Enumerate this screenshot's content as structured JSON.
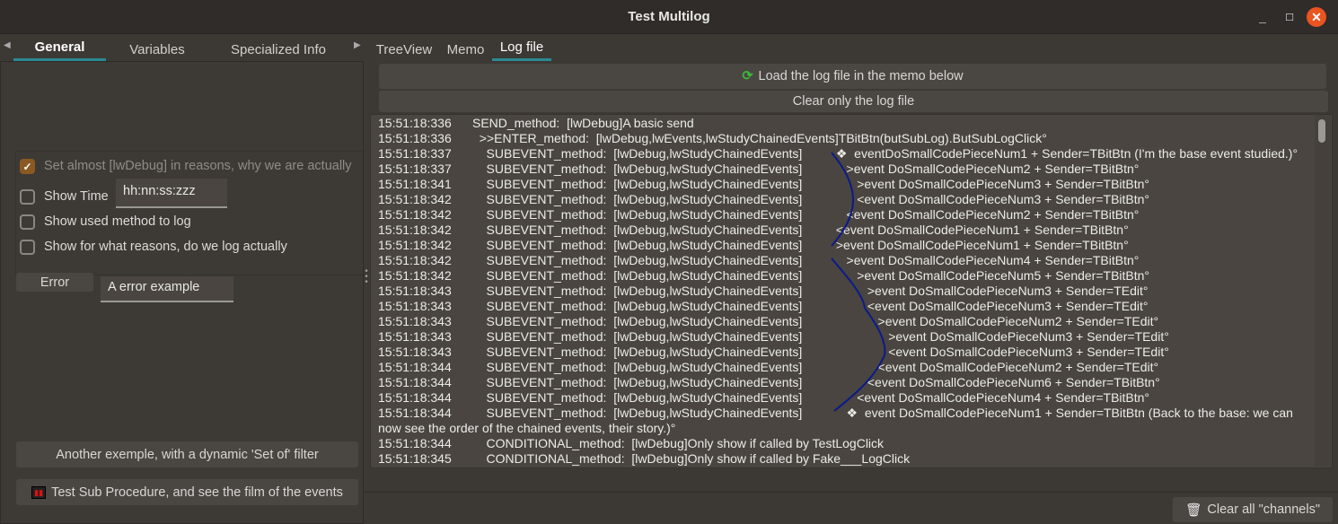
{
  "window": {
    "title": "Test Multilog",
    "minimize": "_",
    "maximize": "□",
    "close": "✕",
    "close_color": "#e95420"
  },
  "left_tabs": [
    {
      "label": "General",
      "active": true
    },
    {
      "label": "Variables"
    },
    {
      "label": "Specialized Info"
    }
  ],
  "right_tabs": [
    {
      "label": "TreeView"
    },
    {
      "label": "Memo"
    },
    {
      "label": "Log file",
      "active": true
    }
  ],
  "general": {
    "options": [
      {
        "label": "Set almost [lwDebug] in reasons, why we are actually",
        "checked": true,
        "disabled": true
      },
      {
        "label": "Show Time",
        "checked": false
      },
      {
        "label": "Show used method to log",
        "checked": false
      },
      {
        "label": "Show for what reasons, do we log actually",
        "checked": false
      }
    ],
    "time_format": "hh:nn:ss:zzz",
    "error_button": "Error",
    "error_text": "A error example",
    "set_of_button": "Another exemple, with a dynamic 'Set of' filter",
    "sub_procedure_button": "Test Sub Procedure, and see the film of the events"
  },
  "logfile": {
    "load_button": "Load the log file in the memo below",
    "clear_button": "Clear only the log file",
    "lines": [
      {
        "time": "15:51:18:336",
        "method": "SEND_method:",
        "tags": "[lwDebug]A basic send",
        "event": ""
      },
      {
        "time": "15:51:18:336",
        "method": "  >>ENTER_method:",
        "tags": "[lwDebug,lwEvents,lwStudyChainedEvents]TBitBtn(butSubLog).ButSubLogClick°",
        "event": ""
      },
      {
        "time": "15:51:18:337",
        "method": "    SUBEVENT_method:",
        "tags": "[lwDebug,lwStudyChainedEvents]",
        "event": "   ❖  eventDoSmallCodePieceNum1 + Sender=TBitBtn (I'm the base event studied.)°"
      },
      {
        "time": "15:51:18:337",
        "method": "    SUBEVENT_method:",
        "tags": "[lwDebug,lwStudyChainedEvents]",
        "event": "      >event DoSmallCodePieceNum2 + Sender=TBitBtn°"
      },
      {
        "time": "15:51:18:341",
        "method": "    SUBEVENT_method:",
        "tags": "[lwDebug,lwStudyChainedEvents]",
        "event": "         >event DoSmallCodePieceNum3 + Sender=TBitBtn°"
      },
      {
        "time": "15:51:18:342",
        "method": "    SUBEVENT_method:",
        "tags": "[lwDebug,lwStudyChainedEvents]",
        "event": "         <event DoSmallCodePieceNum3 + Sender=TBitBtn°"
      },
      {
        "time": "15:51:18:342",
        "method": "    SUBEVENT_method:",
        "tags": "[lwDebug,lwStudyChainedEvents]",
        "event": "      <event DoSmallCodePieceNum2 + Sender=TBitBtn°"
      },
      {
        "time": "15:51:18:342",
        "method": "    SUBEVENT_method:",
        "tags": "[lwDebug,lwStudyChainedEvents]",
        "event": "   <event DoSmallCodePieceNum1 + Sender=TBitBtn°"
      },
      {
        "time": "15:51:18:342",
        "method": "    SUBEVENT_method:",
        "tags": "[lwDebug,lwStudyChainedEvents]",
        "event": "   >event DoSmallCodePieceNum1 + Sender=TBitBtn°"
      },
      {
        "time": "15:51:18:342",
        "method": "    SUBEVENT_method:",
        "tags": "[lwDebug,lwStudyChainedEvents]",
        "event": "      >event DoSmallCodePieceNum4 + Sender=TBitBtn°"
      },
      {
        "time": "15:51:18:342",
        "method": "    SUBEVENT_method:",
        "tags": "[lwDebug,lwStudyChainedEvents]",
        "event": "         >event DoSmallCodePieceNum5 + Sender=TBitBtn°"
      },
      {
        "time": "15:51:18:343",
        "method": "    SUBEVENT_method:",
        "tags": "[lwDebug,lwStudyChainedEvents]",
        "event": "            >event DoSmallCodePieceNum3 + Sender=TEdit°"
      },
      {
        "time": "15:51:18:343",
        "method": "    SUBEVENT_method:",
        "tags": "[lwDebug,lwStudyChainedEvents]",
        "event": "            <event DoSmallCodePieceNum3 + Sender=TEdit°"
      },
      {
        "time": "15:51:18:343",
        "method": "    SUBEVENT_method:",
        "tags": "[lwDebug,lwStudyChainedEvents]",
        "event": "               >event DoSmallCodePieceNum2 + Sender=TEdit°"
      },
      {
        "time": "15:51:18:343",
        "method": "    SUBEVENT_method:",
        "tags": "[lwDebug,lwStudyChainedEvents]",
        "event": "                  >event DoSmallCodePieceNum3 + Sender=TEdit°"
      },
      {
        "time": "15:51:18:343",
        "method": "    SUBEVENT_method:",
        "tags": "[lwDebug,lwStudyChainedEvents]",
        "event": "                  <event DoSmallCodePieceNum3 + Sender=TEdit°"
      },
      {
        "time": "15:51:18:344",
        "method": "    SUBEVENT_method:",
        "tags": "[lwDebug,lwStudyChainedEvents]",
        "event": "               <event DoSmallCodePieceNum2 + Sender=TEdit°"
      },
      {
        "time": "15:51:18:344",
        "method": "    SUBEVENT_method:",
        "tags": "[lwDebug,lwStudyChainedEvents]",
        "event": "            <event DoSmallCodePieceNum6 + Sender=TBitBtn°"
      },
      {
        "time": "15:51:18:344",
        "method": "    SUBEVENT_method:",
        "tags": "[lwDebug,lwStudyChainedEvents]",
        "event": "         <event DoSmallCodePieceNum4 + Sender=TBitBtn°"
      },
      {
        "time": "15:51:18:344",
        "method": "    SUBEVENT_method:",
        "tags": "[lwDebug,lwStudyChainedEvents]",
        "event": "      ❖  event DoSmallCodePieceNum1 + Sender=TBitBtn (Back to the base: we can now see the order of the chained events, their story.)°"
      },
      {
        "time": "15:51:18:344",
        "method": "    CONDITIONAL_method:",
        "tags": "[lwDebug]Only show if called by TestLogClick",
        "event": ""
      },
      {
        "time": "15:51:18:345",
        "method": "    CONDITIONAL_method:",
        "tags": "[lwDebug]Only show if called by Fake___LogClick",
        "event": ""
      }
    ]
  },
  "clear_all_button": "Clear all \"channels\"",
  "colors": {
    "accent_tab": "#2a8a94",
    "curve": "#0a1a8a",
    "checkbox": "#8a5a22"
  }
}
